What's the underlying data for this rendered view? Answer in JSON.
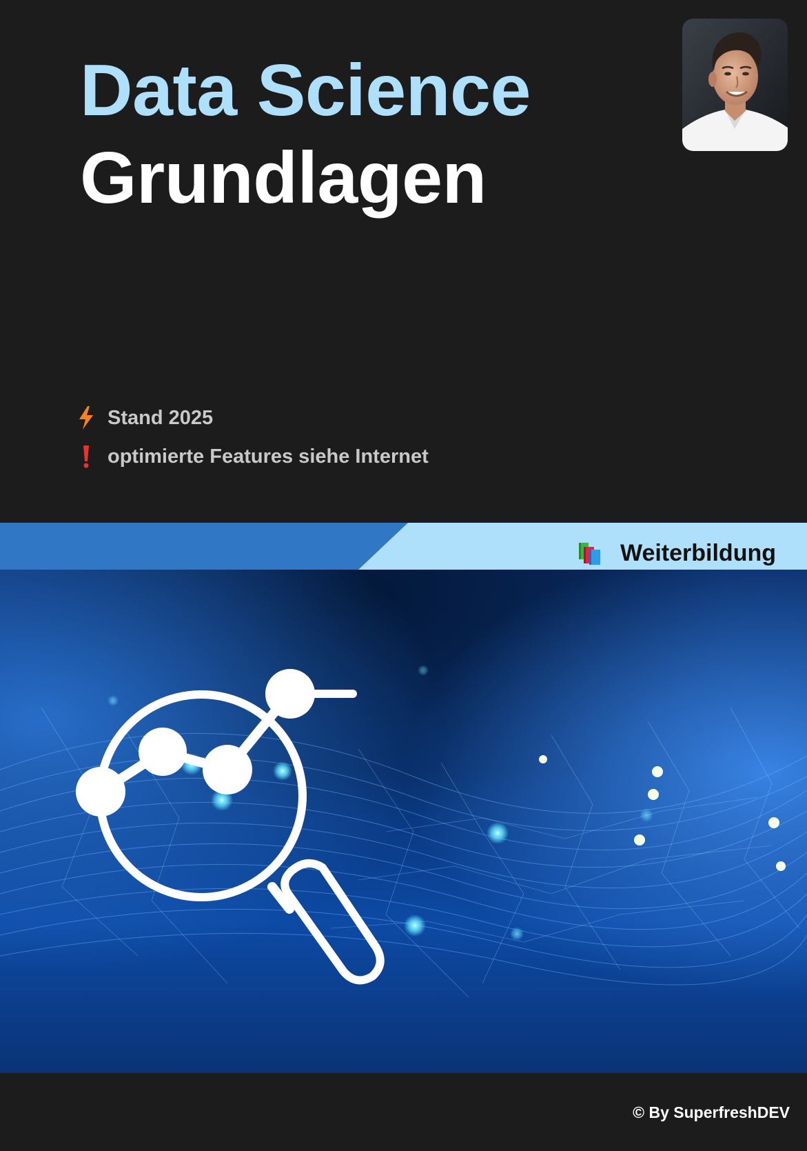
{
  "title": {
    "line1": "Data Science",
    "line2": "Grundlagen"
  },
  "notes": [
    {
      "icon": "lightning-icon",
      "text": "Stand 2025"
    },
    {
      "icon": "exclamation-icon",
      "text": "optimierte Features siehe Internet"
    }
  ],
  "badge": {
    "icon": "books-icon",
    "label": "Weiterbildung"
  },
  "footer": {
    "copyright": "© By SuperfreshDEV"
  },
  "colors": {
    "background": "#1c1c1d",
    "title_accent": "#aee0fb",
    "title_main": "#ffffff",
    "note_text": "#c9c9c9",
    "lightning": "#f5821f",
    "exclamation": "#e8352b",
    "banner_dark": "#3077c5",
    "banner_light": "#aee0fb",
    "badge_text": "#111111",
    "footer_text": "#ffffff"
  }
}
